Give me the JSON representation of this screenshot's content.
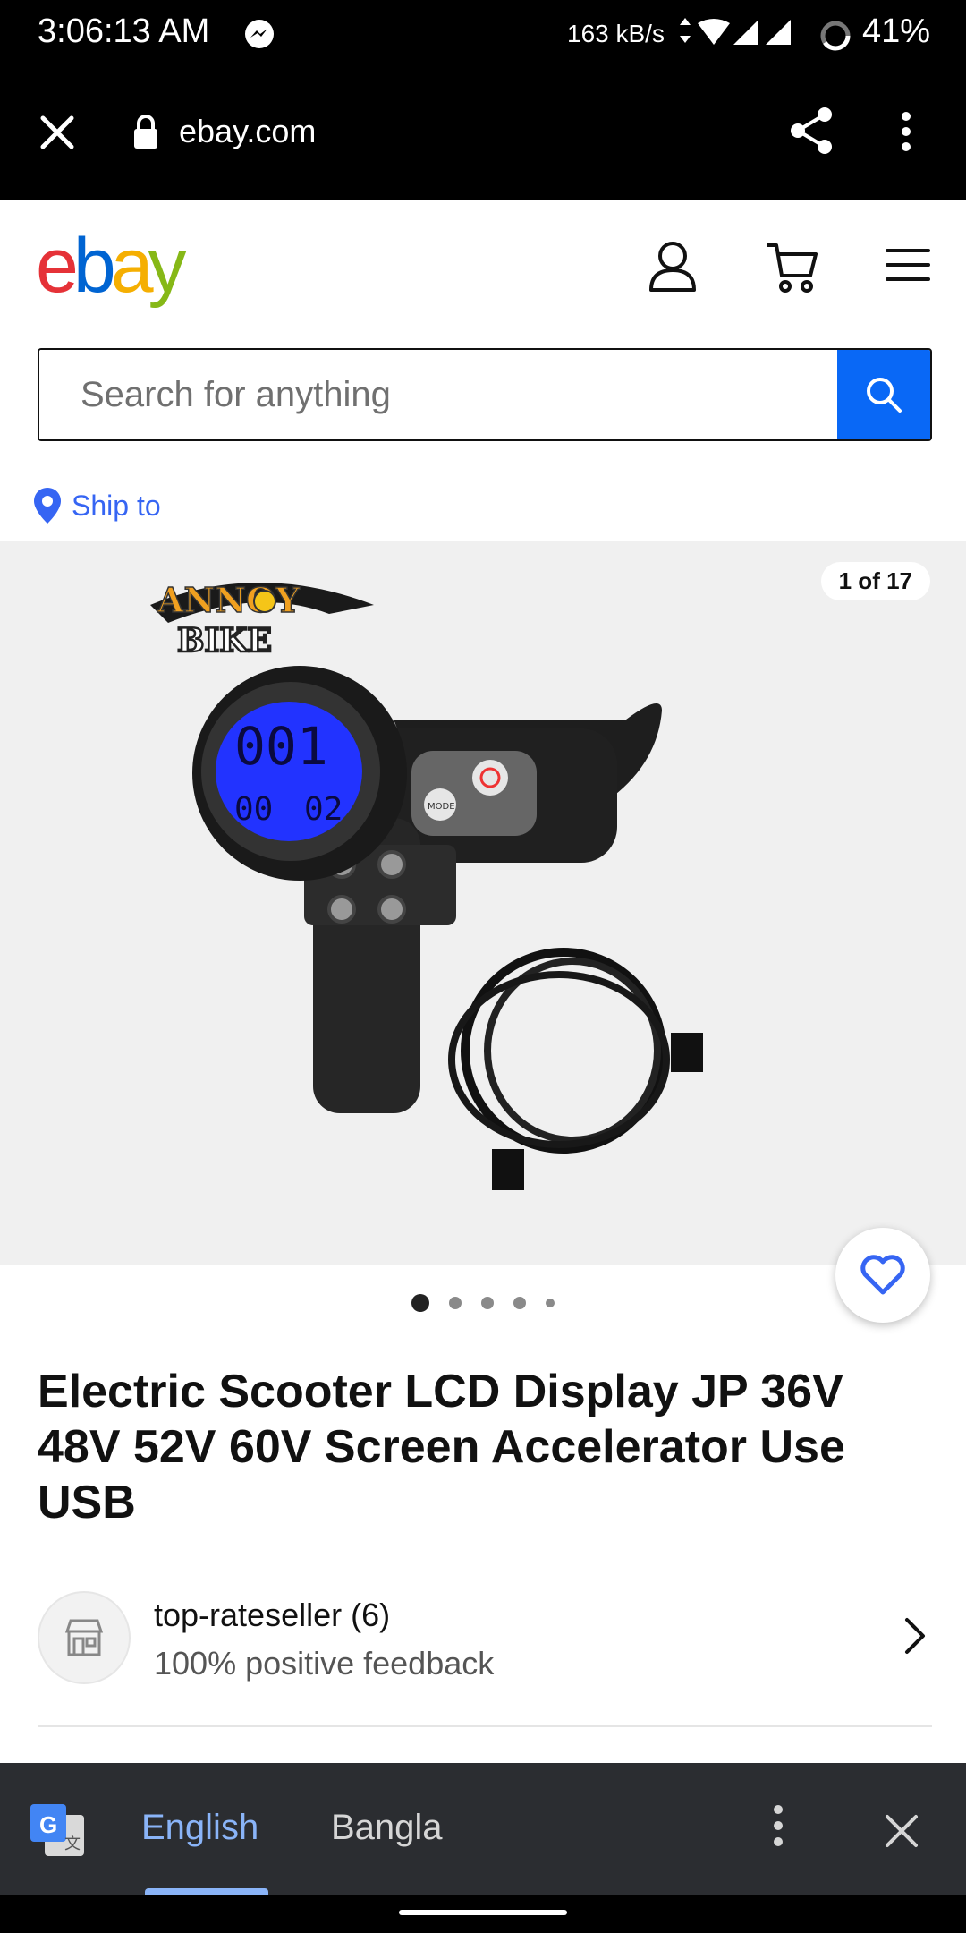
{
  "status_bar": {
    "time": "3:06:13 AM",
    "data_rate": "163 kB/s",
    "battery": "41%",
    "icons": [
      "messenger-icon",
      "wifi-icon",
      "signal-icon",
      "battery-icon"
    ]
  },
  "browser": {
    "url": "ebay.com",
    "icons": [
      "close-icon",
      "lock-icon",
      "share-icon",
      "more-vert-icon"
    ]
  },
  "header": {
    "logo_letters": [
      "e",
      "b",
      "a",
      "y"
    ],
    "logo_colors": [
      "#e53238",
      "#0064d2",
      "#f5af02",
      "#86b817"
    ],
    "icons": [
      "user-icon",
      "cart-icon",
      "menu-icon"
    ]
  },
  "search": {
    "placeholder": "Search for anything",
    "button_color": "#0968f6"
  },
  "ship_to": {
    "label": "Ship to"
  },
  "gallery": {
    "counter": "1 of 17",
    "brand_text": [
      "ANNOY",
      "BIKE"
    ],
    "display_digits": [
      "001",
      "00",
      "02"
    ],
    "mode_label": "MODE",
    "dots": 5,
    "active_dot": 0
  },
  "product": {
    "title": "Electric Scooter LCD Display JP 36V 48V 52V 60V Screen Accelerator Use USB"
  },
  "seller": {
    "name": "top-rateseller (6)",
    "feedback": "100% positive feedback"
  },
  "translate_bar": {
    "languages": [
      "English",
      "Bangla"
    ],
    "selected": "English",
    "accent": "#8ab4f8"
  }
}
